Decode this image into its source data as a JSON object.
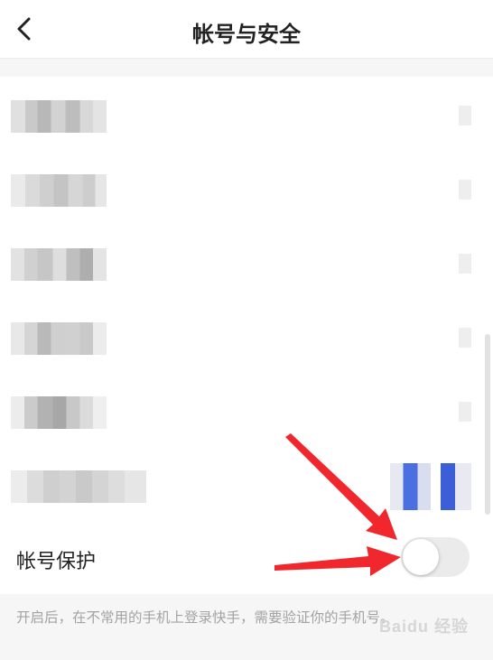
{
  "header": {
    "title": "帐号与安全",
    "back_icon": "chevron-left-icon"
  },
  "account_protection": {
    "label": "帐号保护",
    "enabled": false,
    "hint": "开启后，在不常用的手机上登录快手，需要验证你的手机号。"
  },
  "watermark": "Baidu 经验",
  "colors": {
    "annotation_arrow": "#f0282d",
    "toggle_off": "#ebebeb",
    "hint_text": "#a3a3a3",
    "section_gap": "#f6f6f6"
  }
}
